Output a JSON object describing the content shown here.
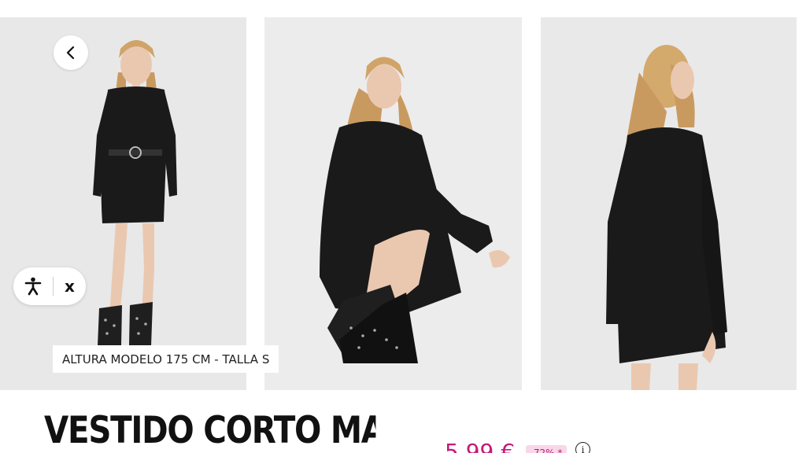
{
  "product": {
    "title": "VESTIDO CORTO MANGA",
    "price": "5,99 €",
    "discount_badge": "-72% *"
  },
  "gallery": {
    "model_caption": "ALTURA MODELO 175 CM - TALLA S",
    "images": [
      "front-view-photo",
      "crouching-side-view-photo",
      "back-view-photo"
    ]
  },
  "accessibility_widget": {
    "icon": "accessibility-person-icon",
    "close_label": "x"
  },
  "navigation": {
    "back_icon": "chevron-left-icon"
  },
  "info_icon": {
    "symbol": "i"
  },
  "colors": {
    "price": "#c4197a",
    "discount_bg": "#f8d7e8",
    "photo_bg": "#e9e9e9",
    "dress": "#1a1a1a"
  }
}
